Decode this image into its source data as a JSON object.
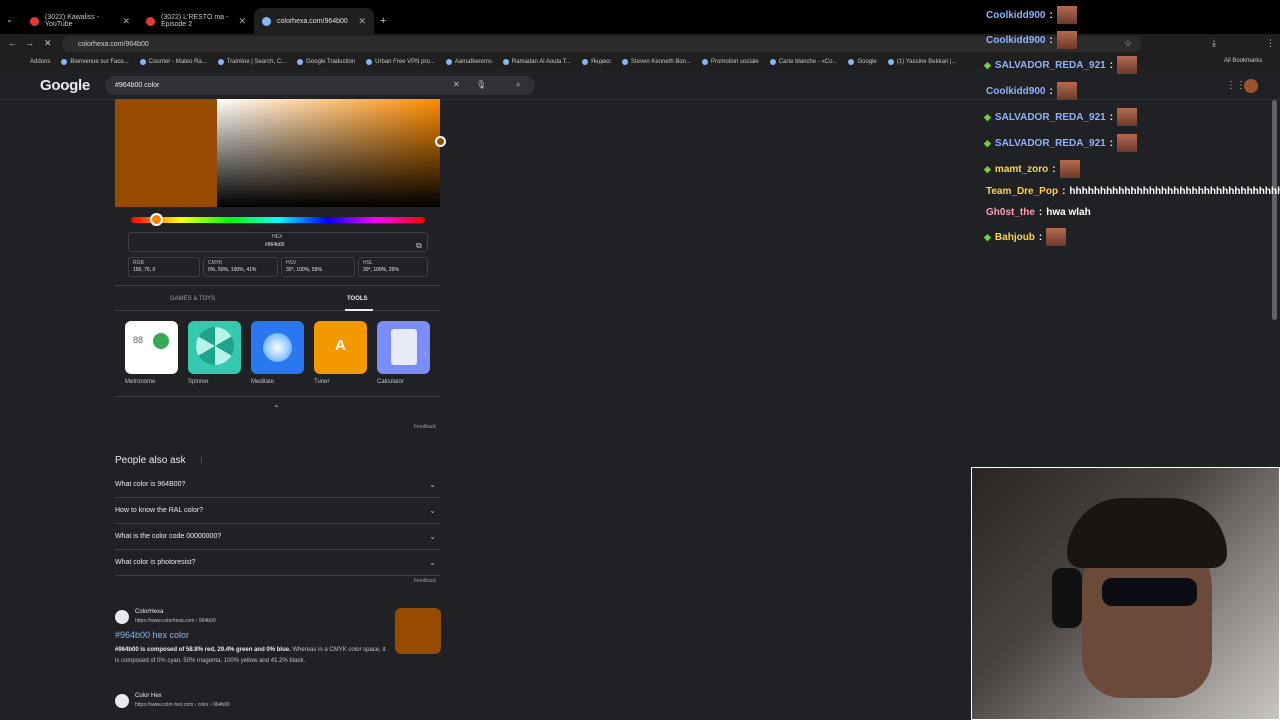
{
  "browser": {
    "tabs": [
      {
        "label": "(3022) Kawaliss - YouTube",
        "active": false
      },
      {
        "label": "(3022) L'RESTO ma - Episode 2",
        "active": false
      },
      {
        "label": "colorhexa.com/964b00",
        "active": true
      }
    ],
    "address": "colorhexa.com/964b00",
    "bookmarks": [
      "Addons",
      "Bienvenue sur Face...",
      "Courrier - Mateo Ra...",
      "Trainline | Search, C...",
      "Google Traduction",
      "Urban Free VPN pro...",
      "Aamafkerems",
      "Ramadan Al Aoula T...",
      "Яндекс",
      "Steven Kenneth Bon...",
      "Promotion sociale",
      "Carte blanche - «Co...",
      "Google",
      "(1) Yassine Bekkari |...",
      "All Bookmarks"
    ]
  },
  "google": {
    "logo": "Google",
    "query": "#964b00 color"
  },
  "picker": {
    "hex_label": "HEX",
    "hex_value": "#964b00",
    "rgb_label": "RGB",
    "rgb_value": "150, 75, 0",
    "cmyk_label": "CMYK",
    "cmyk_value": "0%, 50%, 100%, 41%",
    "hsv_label": "HSV",
    "hsv_value": "30°, 100%, 59%",
    "hsl_label": "HSL",
    "hsl_value": "30°, 100%, 29%",
    "swatch_color": "#964b00"
  },
  "tools": {
    "tab_games": "GAMES & TOYS",
    "tab_tools": "TOOLS",
    "items": [
      {
        "label": "Metronome",
        "metronome_bpm": "88"
      },
      {
        "label": "Spinner"
      },
      {
        "label": "Meditate"
      },
      {
        "label": "Tuner",
        "tuner_note": "A"
      },
      {
        "label": "Calculator"
      }
    ],
    "feedback": "Feedback"
  },
  "paa": {
    "title": "People also ask",
    "questions": [
      "What color is 964B00?",
      "How to know the RAL color?",
      "What is the color code 00000000?",
      "What color is photoresist?"
    ],
    "feedback": "Feedback"
  },
  "result": {
    "site": "ColorHexa",
    "url": "https://www.colorhexa.com › 964b00",
    "title": "#964b00 hex color",
    "snippet_bold": "#964b00 is composed of 58.8% red, 29.4% green and 0% blue.",
    "snippet_rest": " Whereas in a CMYK color space, it is composed of 0% cyan, 50% magenta, 100% yellow and 41.2% black.",
    "site2": "Color Hex",
    "url2": "https://www.color-hex.com › color › 964b00"
  },
  "chat": [
    {
      "user": "Coolkidd900",
      "color": "#8fb2ff",
      "msg": "",
      "emote": true,
      "gem": false
    },
    {
      "user": "Coolkidd900",
      "color": "#8fb2ff",
      "msg": "",
      "emote": true,
      "gem": false
    },
    {
      "user": "SALVADOR_REDA_921",
      "color": "#8fb2ff",
      "msg": "",
      "emote": true,
      "gem": true
    },
    {
      "user": "Coolkidd900",
      "color": "#8fb2ff",
      "msg": "",
      "emote": true,
      "gem": false
    },
    {
      "user": "SALVADOR_REDA_921",
      "color": "#8fb2ff",
      "msg": "",
      "emote": true,
      "gem": true
    },
    {
      "user": "SALVADOR_REDA_921",
      "color": "#8fb2ff",
      "msg": "",
      "emote": true,
      "gem": true
    },
    {
      "user": "mamt_zoro",
      "color": "#ffd34d",
      "msg": "",
      "emote": true,
      "gem": true
    },
    {
      "user": "Team_Dre_Pop",
      "color": "#ffd34d",
      "msg": "hhhhhhhhhhhhhhhhhhhhhhhhhhhhhhhhhhhhh",
      "emote": false,
      "gem": false
    },
    {
      "user": "Gh0st_the",
      "color": "#ff9fb5",
      "msg": "hwa wlah",
      "emote": false,
      "gem": false
    },
    {
      "user": "Bahjoub",
      "color": "#ffd34d",
      "msg": "",
      "emote": true,
      "gem": true
    }
  ]
}
